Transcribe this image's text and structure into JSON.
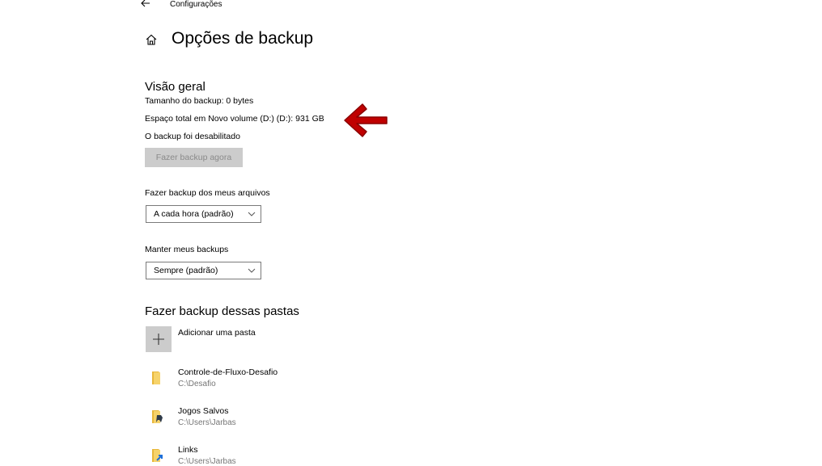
{
  "header": {
    "back_icon": "back-arrow-icon",
    "breadcrumb": "Configurações",
    "home_icon": "home-icon",
    "title": "Opções de backup"
  },
  "overview": {
    "heading": "Visão geral",
    "backup_size": "Tamanho do backup: 0 bytes",
    "total_space": "Espaço total em Novo volume (D:) (D:): 931 GB",
    "status": "O backup foi desabilitado",
    "backup_now_label": "Fazer backup agora"
  },
  "frequency": {
    "label": "Fazer backup dos meus arquivos",
    "value": "A cada hora (padrão)"
  },
  "retention": {
    "label": "Manter meus backups",
    "value": "Sempre (padrão)"
  },
  "folders": {
    "heading": "Fazer backup dessas pastas",
    "add_label": "Adicionar uma pasta",
    "items": [
      {
        "name": "Controle-de-Fluxo-Desafio",
        "path": "C:\\Desafio",
        "icon": "folder-icon"
      },
      {
        "name": "Jogos Salvos",
        "path": "C:\\Users\\Jarbas",
        "icon": "saved-games-folder-icon"
      },
      {
        "name": "Links",
        "path": "C:\\Users\\Jarbas",
        "icon": "links-folder-icon"
      }
    ]
  },
  "annotation": {
    "arrow_color": "#c00000",
    "icon": "red-arrow-icon"
  },
  "colors": {
    "disabled_button_bg": "#cccccc",
    "disabled_button_text": "#8a8a8a",
    "folder_yellow": "#f2c94c"
  }
}
